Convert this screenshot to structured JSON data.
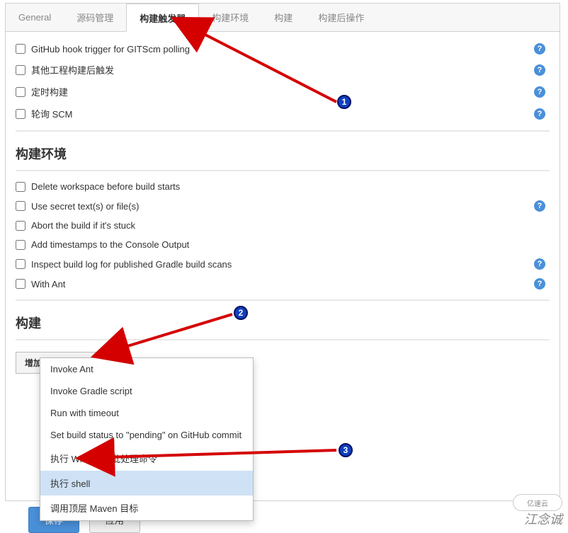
{
  "tabs": [
    {
      "label": "General"
    },
    {
      "label": "源码管理"
    },
    {
      "label": "构建触发器"
    },
    {
      "label": "构建环境"
    },
    {
      "label": "构建"
    },
    {
      "label": "构建后操作"
    }
  ],
  "active_tab": 2,
  "triggers": [
    {
      "label": "GitHub hook trigger for GITScm polling",
      "help": true
    },
    {
      "label": "其他工程构建后触发",
      "help": true
    },
    {
      "label": "定时构建",
      "help": true
    },
    {
      "label": "轮询 SCM",
      "help": true
    }
  ],
  "env_section_title": "构建环境",
  "env_items": [
    {
      "label": "Delete workspace before build starts",
      "help": false
    },
    {
      "label": "Use secret text(s) or file(s)",
      "help": true
    },
    {
      "label": "Abort the build if it's stuck",
      "help": false
    },
    {
      "label": "Add timestamps to the Console Output",
      "help": false
    },
    {
      "label": "Inspect build log for published Gradle build scans",
      "help": true
    },
    {
      "label": "With Ant",
      "help": true
    }
  ],
  "build_section_title": "构建",
  "add_step_label": "增加构建步骤",
  "dropdown_items": [
    "Invoke Ant",
    "Invoke Gradle script",
    "Run with timeout",
    "Set build status to \"pending\" on GitHub commit",
    "执行 Windows 批处理命令",
    "执行 shell",
    "调用顶层 Maven 目标"
  ],
  "dropdown_highlight_index": 5,
  "buttons": {
    "save": "保存",
    "apply": "应用"
  },
  "annotations": {
    "badge1": "1",
    "badge2": "2",
    "badge3": "3"
  },
  "watermark_text": "江念诚",
  "watermark_logo": "亿速云"
}
